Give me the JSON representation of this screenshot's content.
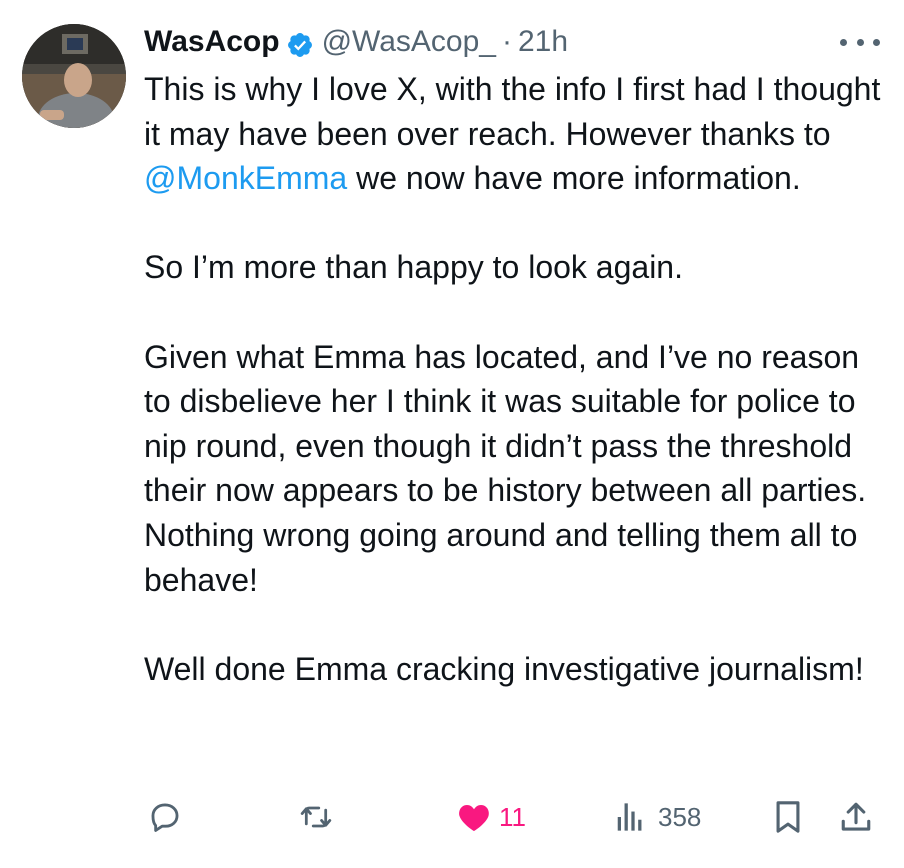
{
  "author": {
    "display_name": "WasAcop",
    "handle": "@WasAcop_",
    "separator": "·",
    "time": "21h",
    "verified": true
  },
  "tweet": {
    "p1_before": "This is why I love X, with the info I first had I thought it may have been over reach. However thanks to ",
    "p1_mention": "@MonkEmma",
    "p1_after": " we now have more information.",
    "p2": "So I’m more than happy to look again.",
    "p3": "Given what Emma has located, and I’ve no reason to disbelieve her I think it was suitable for police to nip round, even though it didn’t pass the threshold their now appears to be history between all parties. Nothing wrong going around and telling them all to behave!",
    "p4": "Well done Emma cracking investigative journalism!"
  },
  "actions": {
    "reply_icon": "reply-icon",
    "repost_icon": "repost-icon",
    "like_icon": "heart-icon",
    "like_count": "11",
    "views_icon": "views-icon",
    "views_count": "358",
    "bookmark_icon": "bookmark-icon",
    "share_icon": "share-icon"
  },
  "colors": {
    "text": "#0f1419",
    "muted": "#536471",
    "link": "#1d9bf0",
    "like": "#f91880",
    "verified": "#1d9bf0"
  }
}
